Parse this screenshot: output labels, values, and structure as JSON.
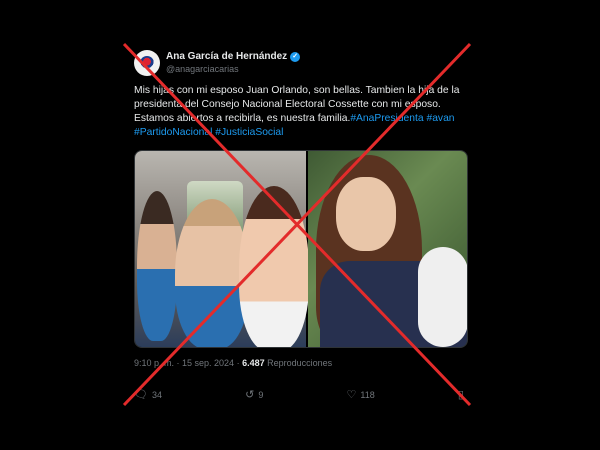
{
  "tweet": {
    "author_name": "Ana García de Hernández",
    "handle": "@anagarciacarias",
    "lines": [
      "Mis hijas con mi esposo Juan Orlando, son bellas. Tambien la hija de la",
      "presidenta del Consejo Nacional Electoral Cossette con mi esposo.",
      "Estamos abiertos a recibirla, es nuestra familia."
    ],
    "line3_tags": "#AnaPresidenta #avan",
    "line4_tags": "#PartidoNacional #JusticiaSocial",
    "timestamp": "9:10 p. m. · 15 sep. 2024 ·",
    "views_count": "6.487",
    "views_label": "Reproducciones",
    "replies": "34",
    "reposts": "9",
    "likes": "118"
  },
  "icons": {
    "reply": "reply-icon",
    "repost": "repost-icon",
    "like": "heart-icon",
    "bookmark": "bookmark-icon"
  },
  "colors": {
    "background": "#000000",
    "link": "#1d9bf0",
    "cross": "#e32b2b"
  }
}
